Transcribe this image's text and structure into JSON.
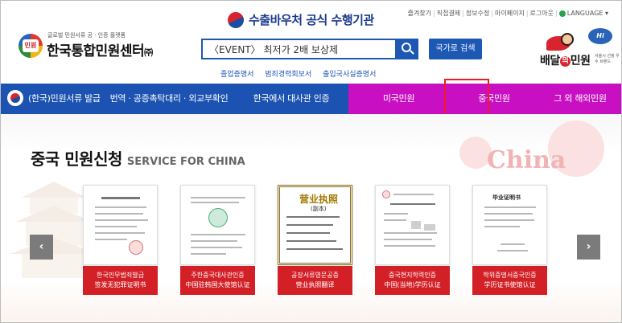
{
  "header": {
    "logo": {
      "badge_text": "민원",
      "subtitle": "글로벌 민원서류 공 · 인증 플랫폼",
      "name": "한국통합민원센터",
      "corp": "㈜"
    },
    "gov_title": "수출바우처 공식 수행기관",
    "top_links": [
      "즐겨찾기",
      "직접결제",
      "정보수정",
      "마이페이지",
      "로그아웃"
    ],
    "language": "LANGUAGE ▾",
    "search": {
      "value": "〈EVENT〉 최저가 2배 보상제",
      "country_button": "국가로 검색"
    },
    "quick_links": [
      "졸업증명서",
      "범죄경력회보서",
      "출입국사실증명서"
    ],
    "baedal": {
      "hi": "Hi",
      "name_left": "배달",
      "name_mid": "의",
      "name_right": "민원",
      "sub": "서울시 선정 우수 브랜드"
    }
  },
  "nav": {
    "items": [
      "(한국)민원서류 발급",
      "번역 · 공증촉탁대리 · 외교부확인",
      "한국에서 대사관 인증",
      "미국민원",
      "중국민원",
      "그 외 해외민원"
    ],
    "colors": {
      "blue": "#1c52b1",
      "pink": "#c90fc2",
      "highlight": "#ee1b23"
    }
  },
  "main": {
    "title_ko": "중국 민원신청",
    "title_en": "SERVICE FOR CHINA",
    "deco_word": "China",
    "arrows": {
      "prev": "‹",
      "next": "›"
    },
    "cards": [
      {
        "caption1": "한국인무범죄발급",
        "caption2": "签发无犯罪证明书"
      },
      {
        "caption1": "주한중국대사관인증",
        "caption2": "中国驻韩国大使馆认证"
      },
      {
        "caption1": "공장서류영문공증",
        "caption2": "营业执照翻译",
        "doc_title": "营业执照",
        "doc_sub": "(副本)"
      },
      {
        "caption1": "중국현지학력인증",
        "caption2": "中国(当地)学历认证"
      },
      {
        "caption1": "학위증명서중국인증",
        "caption2": "学历证书使馆认证",
        "doc_title": "毕业证明书"
      }
    ],
    "caption_color": "#d32027"
  }
}
